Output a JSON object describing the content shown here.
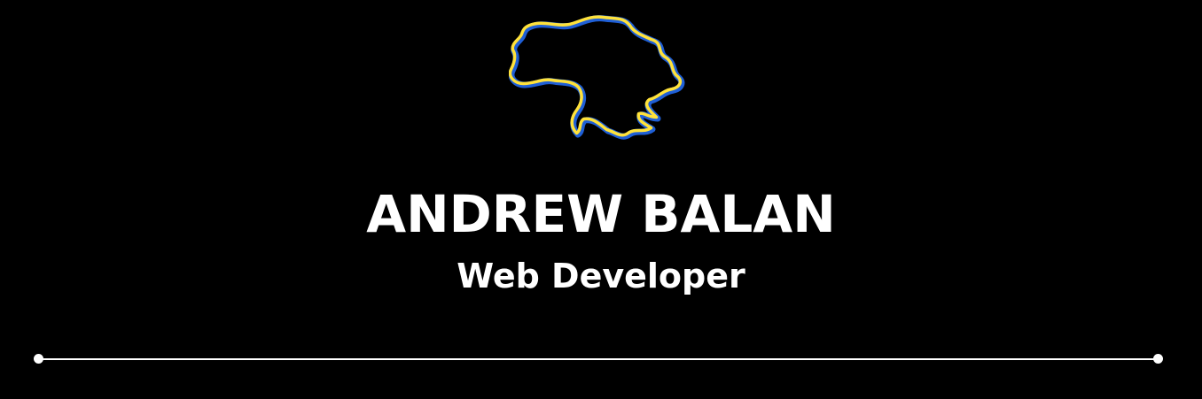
{
  "header": {
    "logo_icon": "ukraine-map-outline-icon",
    "name": "ANDREW BALAN",
    "role": "Web Developer"
  },
  "colors": {
    "background": "#000000",
    "text": "#ffffff",
    "outline_blue": "#1f5fd6",
    "outline_yellow": "#ffe23a"
  }
}
